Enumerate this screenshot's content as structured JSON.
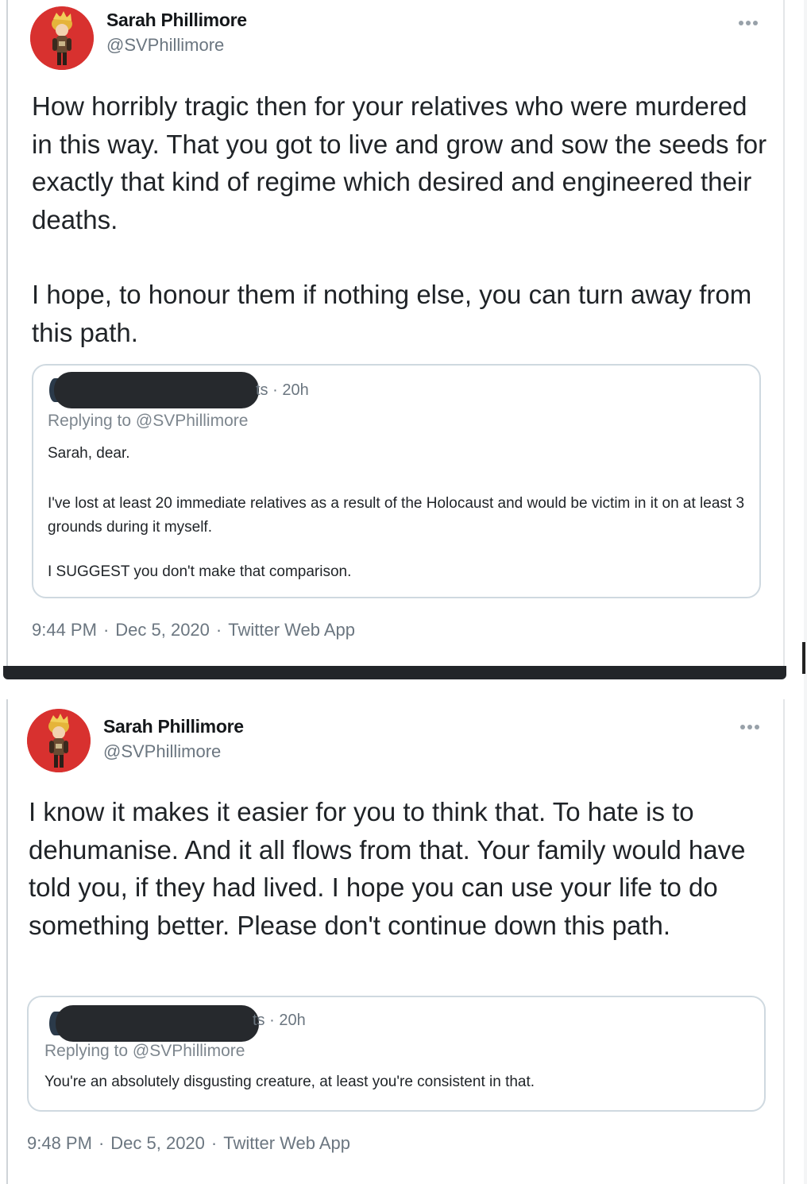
{
  "tweets": [
    {
      "author_name": "Sarah Phillimore",
      "author_handle": "@SVPhillimore",
      "paragraph_1": "How horribly tragic then for your relatives who were murdered in this way. That you got to live and grow and sow the seeds for exactly that kind of regime which desired and engineered their deaths.",
      "paragraph_2": "I hope, to honour them if nothing else, you can turn away from this path.",
      "quote": {
        "meta": "ts · 20h",
        "replying_to": "Replying to @SVPhillimore",
        "line_1": "Sarah, dear.",
        "line_2": "I've lost at least 20 immediate relatives as a result of the Holocaust and would be victim in it on at least 3 grounds during it myself.",
        "line_3": "I SUGGEST you don't make that comparison."
      },
      "time": "9:44 PM",
      "date": "Dec 5, 2020",
      "source": "Twitter Web App"
    },
    {
      "author_name": "Sarah Phillimore",
      "author_handle": "@SVPhillimore",
      "paragraph_1": "I know it makes it easier for you to think that. To hate is to dehumanise. And it all flows from that. Your family would have told you, if they had lived. I hope you can use your life to do something better. Please don't continue down this path.",
      "quote": {
        "meta": "ts · 20h",
        "replying_to": "Replying to @SVPhillimore",
        "line_1": "You're an absolutely disgusting creature, at least you're consistent in that."
      },
      "time": "9:48 PM",
      "date": "Dec 5, 2020",
      "source": "Twitter Web App"
    }
  ],
  "separator": "·",
  "icons": {
    "avatar": "avatar-illustration",
    "more": "more-options-icon"
  },
  "colors": {
    "avatar_bg": "#d8312f",
    "secondary_text": "#6b7680",
    "quote_border": "#cfd9e0",
    "redaction": "#26292d"
  }
}
